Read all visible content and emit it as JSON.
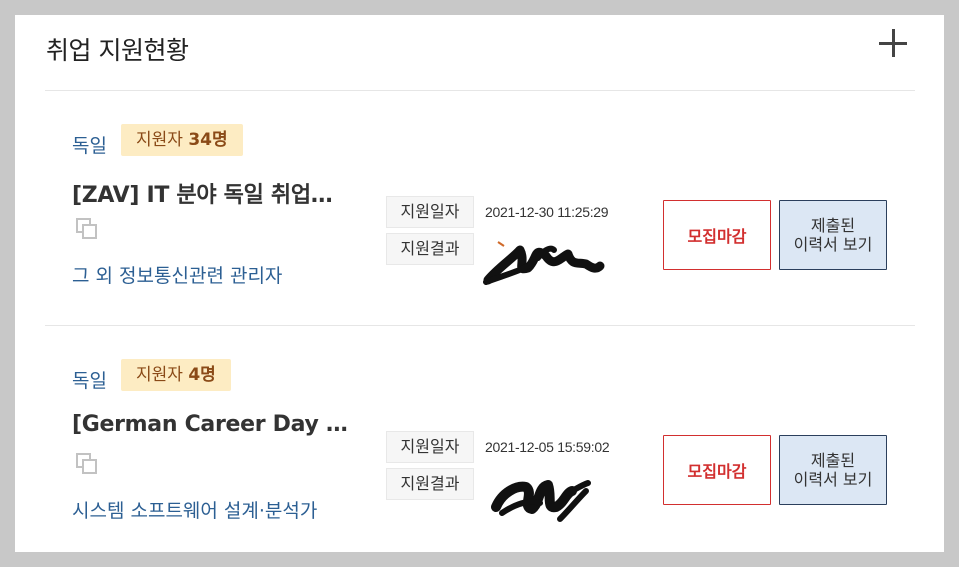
{
  "header": {
    "title": "취업 지원현황",
    "add_icon": "plus-icon"
  },
  "items": [
    {
      "country": "독일",
      "badge_prefix": "지원자 ",
      "badge_count": "34명",
      "title": "[ZAV] IT 분야 독일 취업…",
      "category": "그 외 정보통신관련 관리자",
      "apply_date_label": "지원일자",
      "apply_date": "2021-12-30 11:25:29",
      "result_label": "지원결과",
      "status_button": "모집마감",
      "resume_line1": "제출된",
      "resume_line2": "이력서 보기"
    },
    {
      "country": "독일",
      "badge_prefix": "지원자 ",
      "badge_count": "4명",
      "title": "[German Career Day …",
      "category": "시스템 소프트웨어 설계·분석가",
      "apply_date_label": "지원일자",
      "apply_date": "2021-12-05 15:59:02",
      "result_label": "지원결과",
      "status_button": "모집마감",
      "resume_line1": "제출된",
      "resume_line2": "이력서 보기"
    }
  ],
  "colors": {
    "accent_blue": "#2c5f93",
    "badge_bg": "#fdecc3",
    "badge_text": "#8a4a17",
    "closed_red": "#d22f2f",
    "resume_bg": "#dce7f4"
  }
}
